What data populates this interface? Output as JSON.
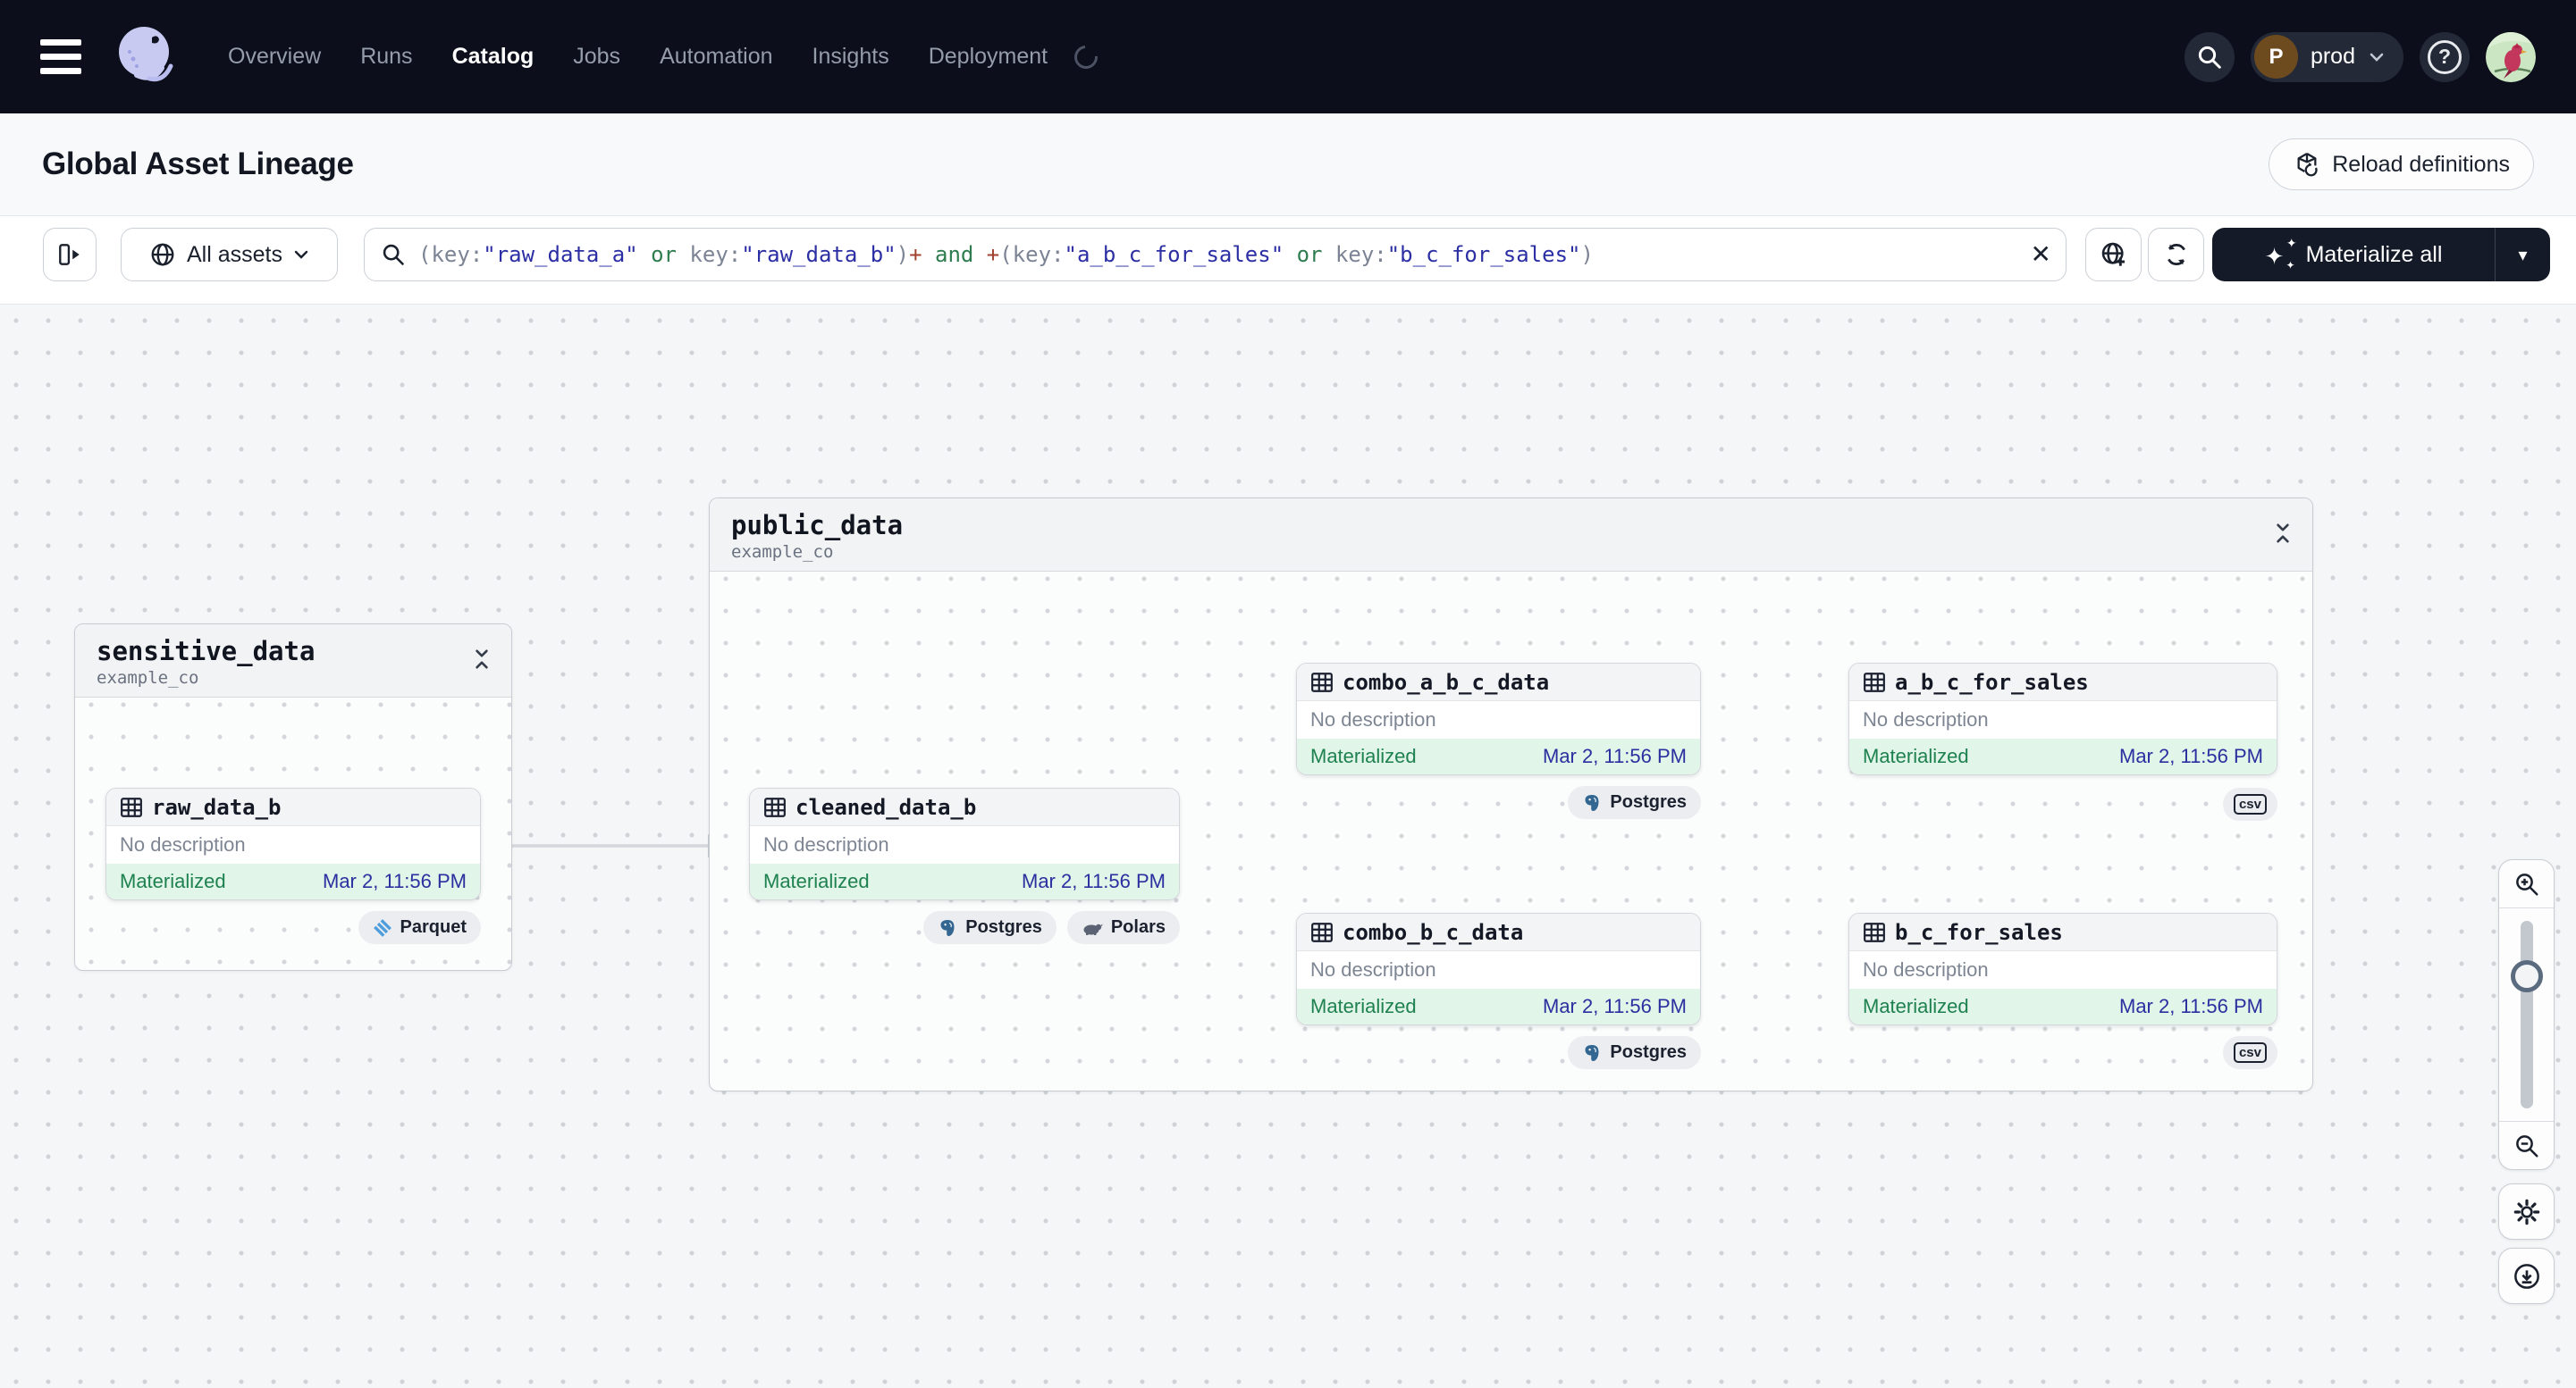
{
  "navbar": {
    "items": [
      {
        "label": "Overview"
      },
      {
        "label": "Runs"
      },
      {
        "label": "Catalog"
      },
      {
        "label": "Jobs"
      },
      {
        "label": "Automation"
      },
      {
        "label": "Insights"
      },
      {
        "label": "Deployment"
      }
    ],
    "deployment": {
      "initial": "P",
      "label": "prod"
    }
  },
  "page": {
    "title": "Global Asset Lineage",
    "reload_label": "Reload definitions"
  },
  "toolbar": {
    "scope_label": "All assets",
    "materialize_label": "Materialize all",
    "query_tokens": [
      {
        "text": "(key:"
      },
      {
        "text": "\"raw_data_a\""
      },
      {
        "text": " "
      },
      {
        "text": "or"
      },
      {
        "text": " "
      },
      {
        "text": "key:"
      },
      {
        "text": "\"raw_data_b\""
      },
      {
        "text": ")"
      },
      {
        "text": "+"
      },
      {
        "text": " and "
      },
      {
        "text": "+"
      },
      {
        "text": "(key:"
      },
      {
        "text": "\"a_b_c_for_sales\""
      },
      {
        "text": " or "
      },
      {
        "text": "key:"
      },
      {
        "text": "\"b_c_for_sales\""
      },
      {
        "text": ")"
      }
    ]
  },
  "icons": {
    "close": "✕",
    "caret": "▾",
    "help": "?",
    "sparkle": "✦"
  },
  "graph": {
    "groups": [
      {
        "name": "sensitive_data",
        "location": "example_co"
      },
      {
        "name": "public_data",
        "location": "example_co"
      }
    ],
    "assets": [
      {
        "name": "raw_data_b",
        "description": "No description",
        "status": "Materialized",
        "timestamp": "Mar 2, 11:56 PM",
        "tags": [
          {
            "label": "Parquet"
          }
        ]
      },
      {
        "name": "cleaned_data_b",
        "description": "No description",
        "status": "Materialized",
        "timestamp": "Mar 2, 11:56 PM",
        "tags": [
          {
            "label": "Postgres"
          },
          {
            "label": "Polars"
          }
        ]
      },
      {
        "name": "combo_a_b_c_data",
        "description": "No description",
        "status": "Materialized",
        "timestamp": "Mar 2, 11:56 PM",
        "tags": [
          {
            "label": "Postgres"
          }
        ]
      },
      {
        "name": "a_b_c_for_sales",
        "description": "No description",
        "status": "Materialized",
        "timestamp": "Mar 2, 11:56 PM",
        "tags": [
          {
            "label": "csv"
          }
        ]
      },
      {
        "name": "combo_b_c_data",
        "description": "No description",
        "status": "Materialized",
        "timestamp": "Mar 2, 11:56 PM",
        "tags": [
          {
            "label": "Postgres"
          }
        ]
      },
      {
        "name": "b_c_for_sales",
        "description": "No description",
        "status": "Materialized",
        "timestamp": "Mar 2, 11:56 PM",
        "tags": [
          {
            "label": "csv"
          }
        ]
      }
    ]
  },
  "colors": {
    "accent_green": "#1E8150",
    "status_bg": "#E1F5E8",
    "timestamp_blue": "#2B2FA0",
    "nav_bg": "#0C0F1B",
    "materialize_bg": "#141A27"
  }
}
